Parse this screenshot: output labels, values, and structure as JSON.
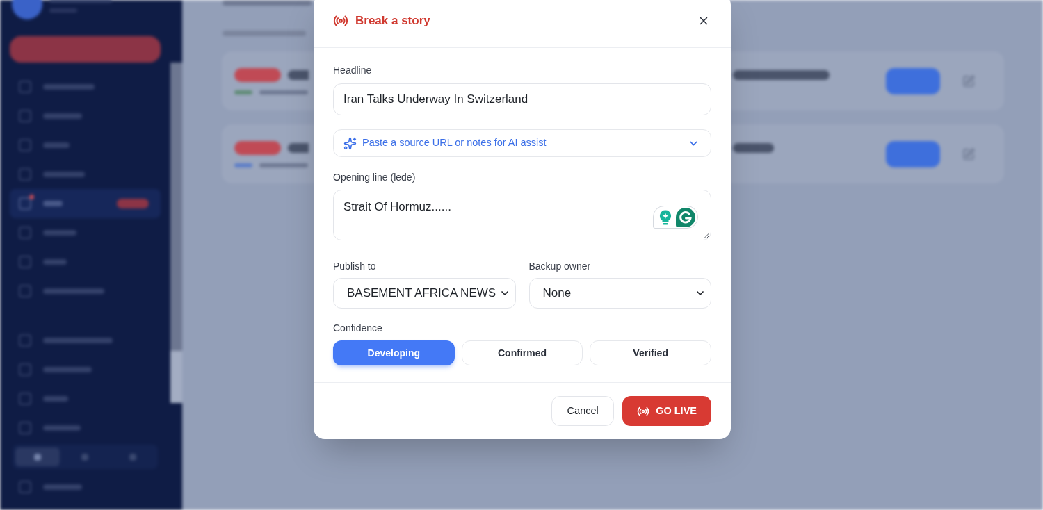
{
  "sidebar": {
    "menu_groups": [
      {
        "items": [
          {
            "selected": false
          },
          {
            "selected": false
          },
          {
            "selected": false
          },
          {
            "selected": false
          },
          {
            "selected": true
          },
          {
            "selected": false
          },
          {
            "selected": false
          },
          {
            "selected": false
          }
        ]
      },
      {
        "items": [
          {
            "selected": false
          },
          {
            "selected": false
          },
          {
            "selected": false
          },
          {
            "selected": false
          }
        ]
      }
    ],
    "mode_toggle": [
      {
        "selected": true
      },
      {
        "selected": false
      },
      {
        "selected": false
      }
    ]
  },
  "dialog": {
    "title": "Break a story",
    "headline": {
      "label": "Headline",
      "value": "Iran Talks Underway In Switzerland"
    },
    "ai_assist": {
      "label": "Paste a source URL or notes for AI assist",
      "expanded": false
    },
    "lede": {
      "label": "Opening line (lede)",
      "value": "Strait Of Hormuz......"
    },
    "publish_to": {
      "label": "Publish to",
      "value": "BASEMENT AFRICA NEWS"
    },
    "backup_owner": {
      "label": "Backup owner",
      "value": "None"
    },
    "confidence": {
      "label": "Confidence",
      "options": [
        {
          "label": "Developing",
          "selected": true
        },
        {
          "label": "Confirmed",
          "selected": false
        },
        {
          "label": "Verified",
          "selected": false
        }
      ]
    },
    "buttons": [
      {
        "label": "Cancel",
        "kind": "secondary"
      },
      {
        "label": "GO LIVE",
        "kind": "primary"
      }
    ]
  }
}
